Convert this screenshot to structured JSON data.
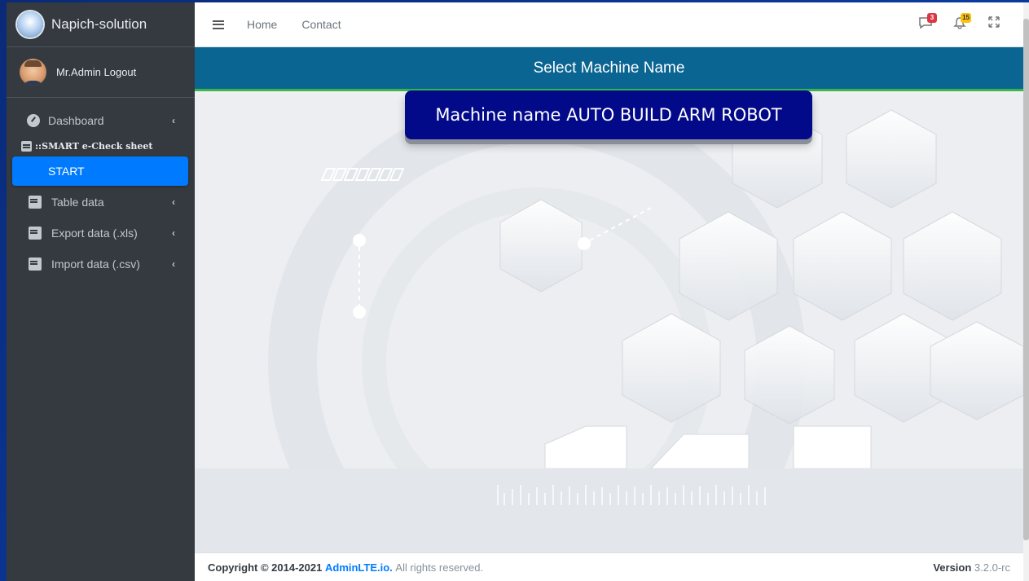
{
  "brand": {
    "name": "Napich-solution"
  },
  "user": {
    "label": "Mr.Admin Logout"
  },
  "sidebar": {
    "items": [
      {
        "label": "Dashboard",
        "icon": "gauge-icon"
      },
      {
        "label": "::SMART e-Check sheet",
        "icon": "document-icon"
      },
      {
        "label": "START",
        "icon": "table-icon"
      },
      {
        "label": "Table data",
        "icon": "document-icon"
      },
      {
        "label": "Export data (.xls)",
        "icon": "document-icon"
      },
      {
        "label": "Import data (.csv)",
        "icon": "document-icon"
      }
    ]
  },
  "topbar": {
    "home": "Home",
    "contact": "Contact",
    "messages_count": "3",
    "notifications_count": "15"
  },
  "content": {
    "title": "Select Machine Name",
    "machine_button": "Machine name AUTO BUILD ARM ROBOT"
  },
  "footer": {
    "copyright_prefix": "Copyright © 2014-2021",
    "link": "AdminLTE.io.",
    "suffix": "All rights reserved.",
    "version_label": "Version",
    "version": "3.2.0-rc"
  },
  "colors": {
    "accent": "#007bff",
    "title_bar": "#0b6592",
    "machine_button": "#030a8a"
  }
}
